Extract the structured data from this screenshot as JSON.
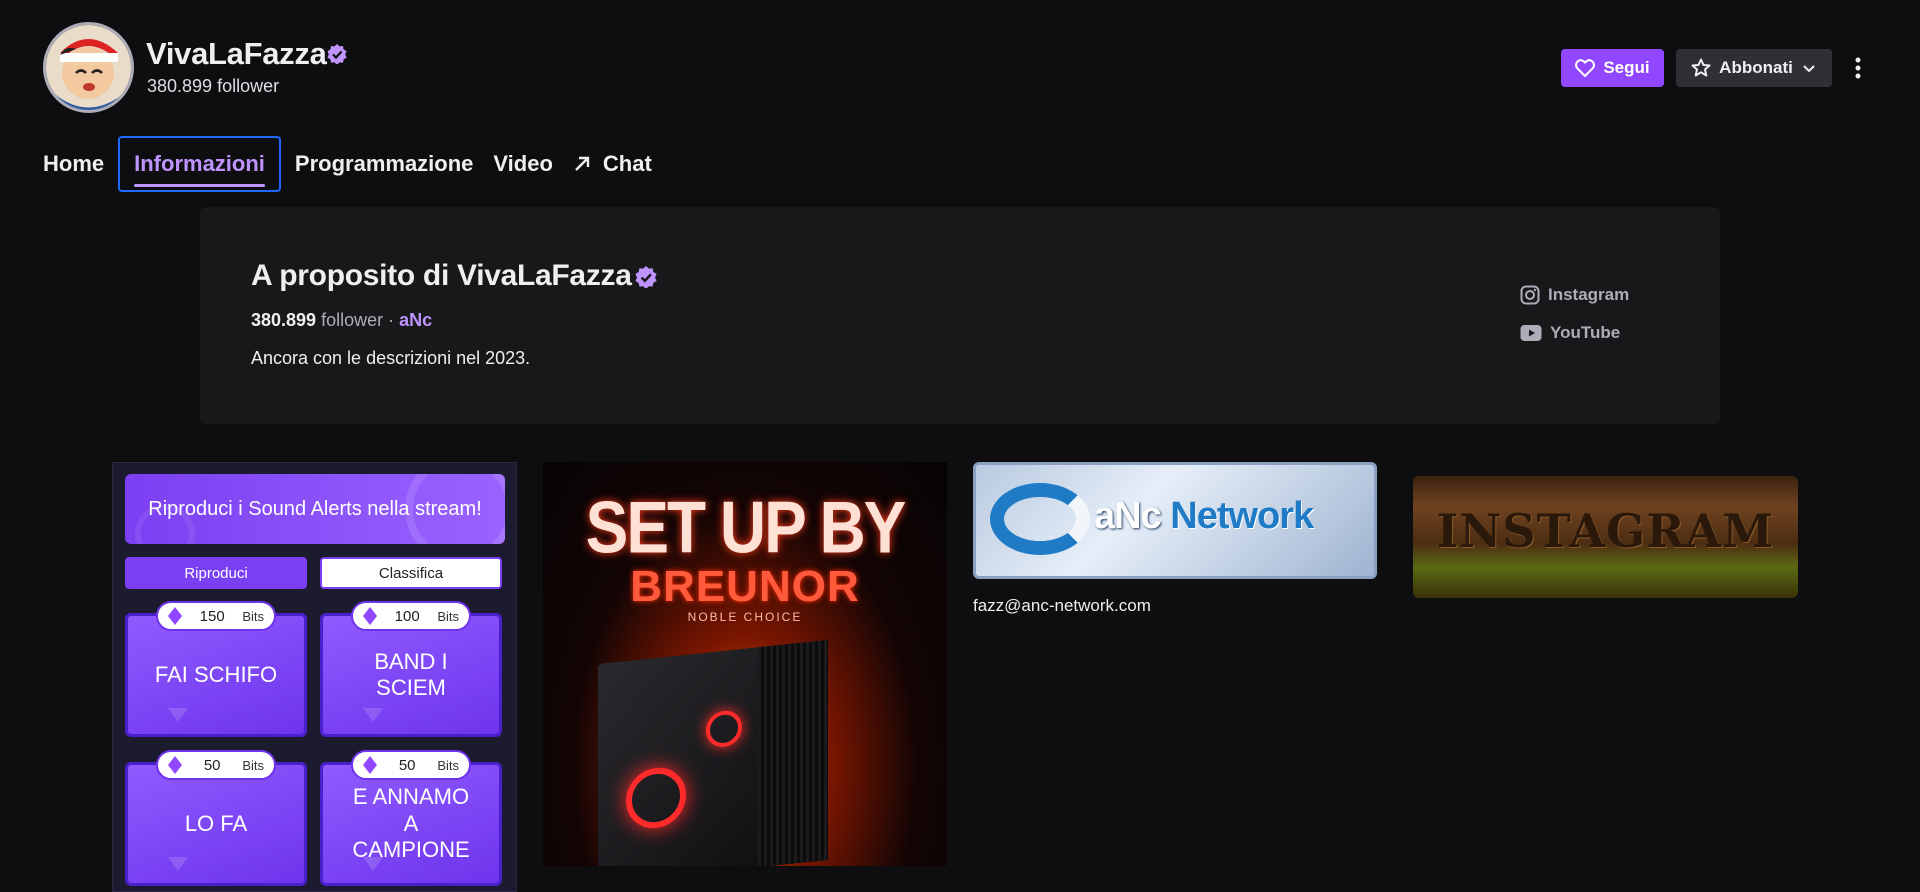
{
  "channel": {
    "name": "VivaLaFazza",
    "followers_label": "380.899 follower"
  },
  "actions": {
    "follow_label": "Segui",
    "subscribe_label": "Abbonati"
  },
  "tabs": [
    {
      "label": "Home"
    },
    {
      "label": "Informazioni"
    },
    {
      "label": "Programmazione"
    },
    {
      "label": "Video"
    },
    {
      "label": "Chat"
    }
  ],
  "about": {
    "title": "A proposito di VivaLaFazza",
    "follower_count": "380.899",
    "follower_word": "follower",
    "separator": "·",
    "team": "aNc",
    "description": "Ancora con le descrizioni nel 2023.",
    "socials": [
      {
        "label": "Instagram",
        "icon": "instagram-icon"
      },
      {
        "label": "YouTube",
        "icon": "youtube-icon"
      }
    ]
  },
  "sound_alerts": {
    "header": "Riproduci i Sound Alerts nella stream!",
    "tab_play": "Riproduci",
    "tab_leaderboard": "Classifica",
    "bits_label": "Bits",
    "items": [
      {
        "label": "FAI SCHIFO",
        "bits": "150"
      },
      {
        "label": "BAND I SCIEM",
        "bits": "100"
      },
      {
        "label": "LO FA",
        "bits": "50"
      },
      {
        "label": "E ANNAMO A CAMPIONE",
        "bits": "50"
      }
    ]
  },
  "panels": {
    "breunor_line1": "SET UP BY",
    "breunor_line2": "BREUNOR",
    "breunor_line3": "NOBLE CHOICE",
    "anc_logo_a": "aNc",
    "anc_logo_b": "Network",
    "anc_email": "fazz@anc-network.com",
    "instagram_banner": "INSTAGRAM"
  },
  "colors": {
    "background": "#0e0e10",
    "accent": "#9147ff",
    "accent_text": "#bf94ff",
    "focus": "#1f69ff"
  }
}
